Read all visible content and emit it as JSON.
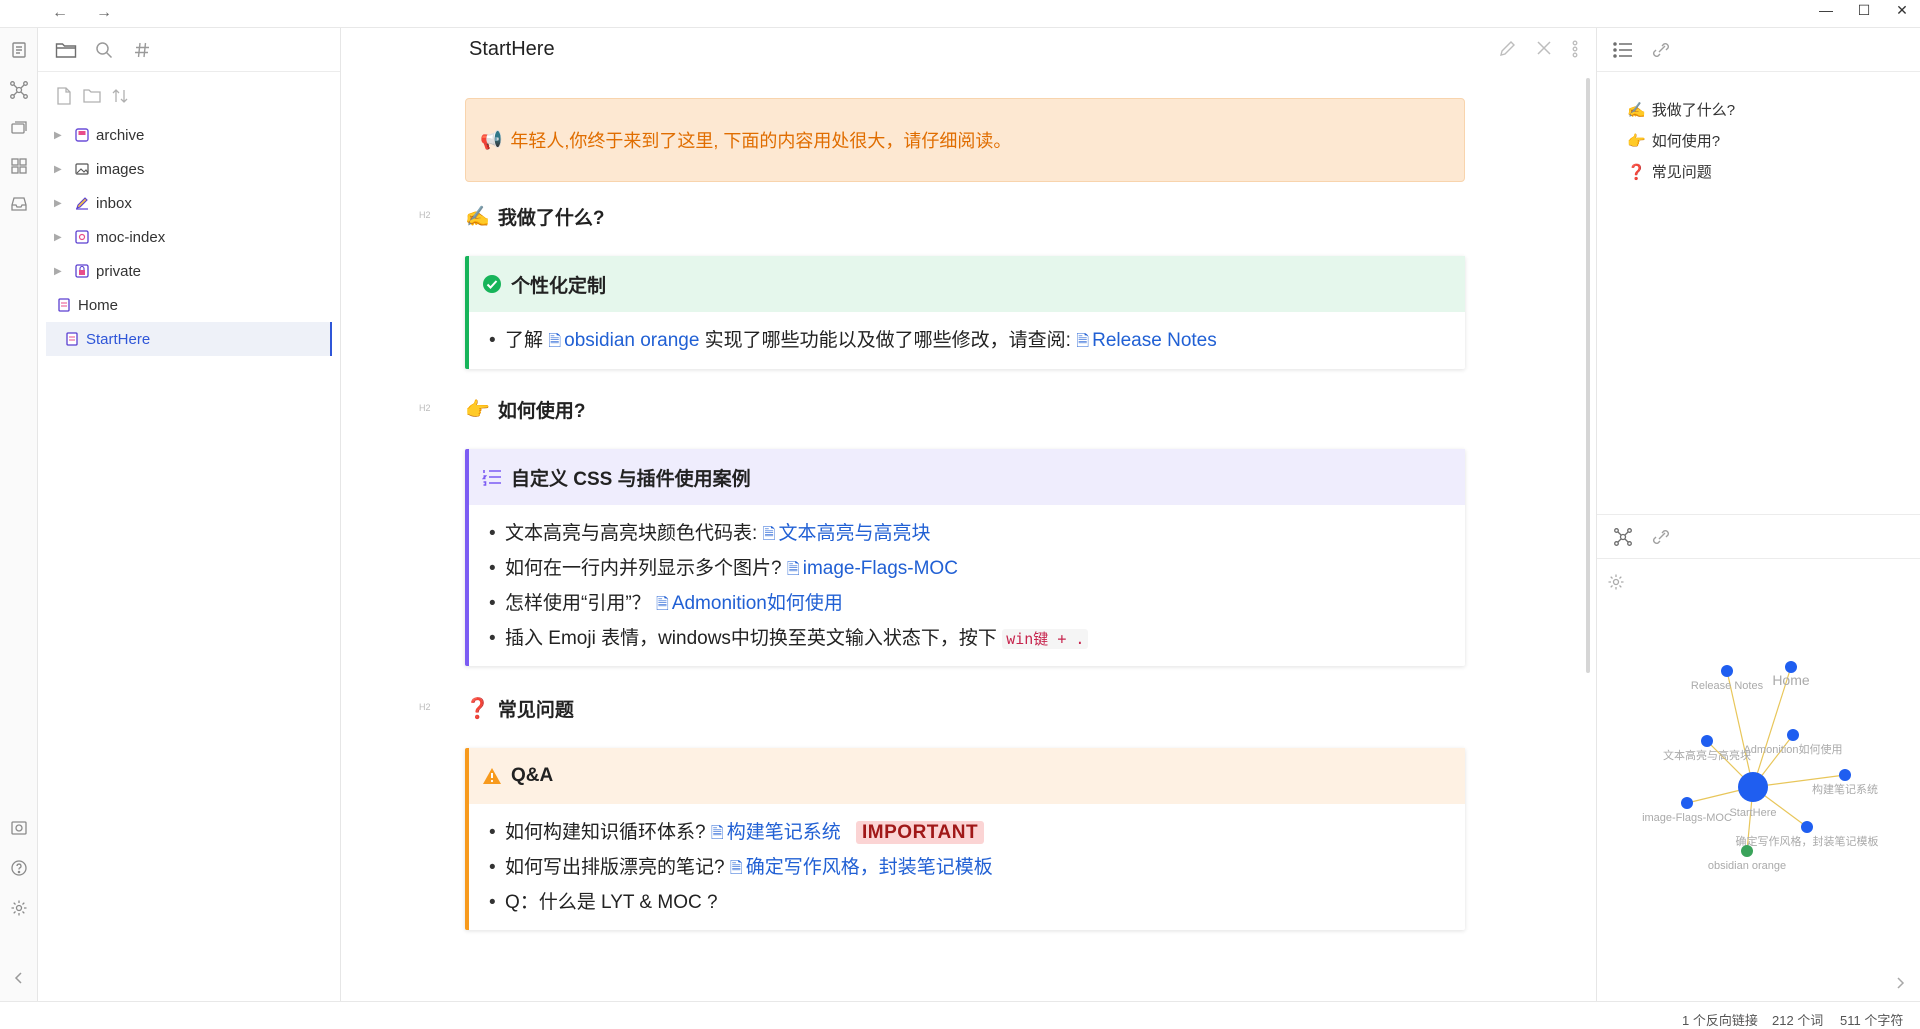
{
  "window": {
    "nav_back": "←",
    "nav_forward": "→",
    "minimize": "—",
    "maximize": "☐",
    "close": "✕"
  },
  "explorer": {
    "items": [
      {
        "label": "archive",
        "type": "folder",
        "icon": "archive-folder-icon"
      },
      {
        "label": "images",
        "type": "folder",
        "icon": "image-folder-icon"
      },
      {
        "label": "inbox",
        "type": "folder",
        "icon": "pencil-folder-icon"
      },
      {
        "label": "moc-index",
        "type": "folder",
        "icon": "index-folder-icon"
      },
      {
        "label": "private",
        "type": "folder",
        "icon": "lock-folder-icon"
      },
      {
        "label": "Home",
        "type": "file",
        "icon": "note-icon"
      },
      {
        "label": "StartHere",
        "type": "file",
        "icon": "note-icon",
        "active": true
      }
    ]
  },
  "editor": {
    "title": "StartHere",
    "banner": {
      "emoji": "📢",
      "text": "年轻人,你终于来到了这里, 下面的内容用处很大，请仔细阅读。"
    },
    "h2_tag": "H2",
    "section1": {
      "emoji": "✍️",
      "heading": "我做了什么?",
      "callout_title": "个性化定制",
      "item": {
        "prefix": "了解",
        "link1": "obsidian orange",
        "middle": "实现了哪些功能以及做了哪些修改，请查阅:",
        "link2": "Release Notes"
      }
    },
    "section2": {
      "emoji": "👉",
      "heading": "如何使用?",
      "callout_title": "自定义 CSS 与插件使用案例",
      "items": [
        {
          "text": "文本高亮与高亮块颜色代码表:",
          "link": "文本高亮与高亮块"
        },
        {
          "text": "如何在一行内并列显示多个图片?",
          "link": "image-Flags-MOC"
        },
        {
          "text": "怎样使用“引用”？",
          "link": "Admonition如何使用"
        }
      ],
      "item4_text": "插入 Emoji 表情，windows中切换至英文输入状态下，按下",
      "item4_code": "win键 + ."
    },
    "section3": {
      "emoji": "❓",
      "heading": "常见问题",
      "callout_title": "Q&A",
      "item1_text": "如何构建知识循环体系?",
      "item1_link": "构建笔记系统",
      "item1_badge": "IMPORTANT",
      "item2_text": "如何写出排版漂亮的笔记?",
      "item2_link": "确定写作风格，封装笔记模板",
      "item3_text": "Q：什么是 LYT & MOC ?"
    }
  },
  "outline": {
    "items": [
      {
        "emoji": "✍️",
        "label": "我做了什么?"
      },
      {
        "emoji": "👉",
        "label": "如何使用?"
      },
      {
        "emoji": "❓",
        "label": "常见问题"
      }
    ]
  },
  "graph": {
    "nodes": [
      "Release Notes",
      "Home",
      "Admonition如何使用",
      "文本高亮与高亮块",
      "构建笔记系统",
      "StartHere",
      "image-Flags-MOC",
      "确定写作风格，封装笔记模板",
      "obsidian orange"
    ],
    "node_color": "#1f5ef0",
    "current_color": "#3aa35a",
    "edge_color": "#e8c65a"
  },
  "status": {
    "backlinks": "1 个反向链接",
    "words": "212 个词",
    "chars": "511 个字符"
  },
  "colors": {
    "accent": "#2f56d8",
    "link": "#2160d4",
    "green": "#17b45a",
    "purple": "#7c5cf3",
    "orange": "#f79a1d"
  }
}
